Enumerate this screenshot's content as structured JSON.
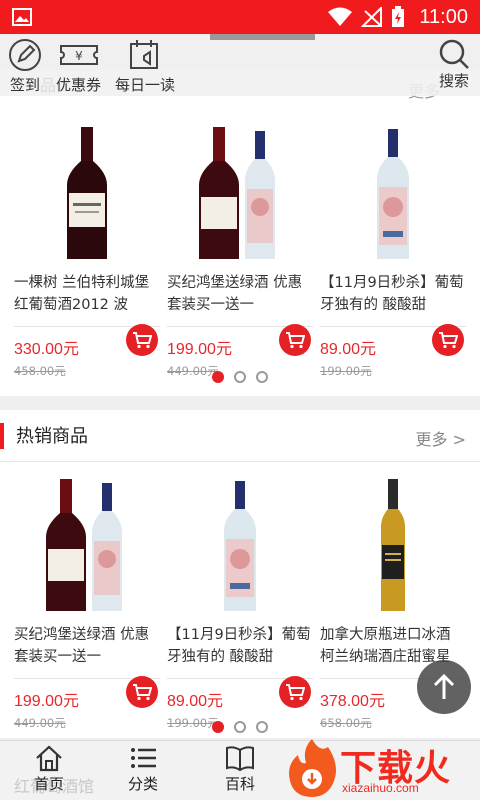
{
  "status": {
    "time": "11:00"
  },
  "toolbar": {
    "items": [
      {
        "label": "签到",
        "icon": "pencil-icon"
      },
      {
        "label": "优惠券",
        "icon": "coupon-icon"
      },
      {
        "label": "每日一读",
        "icon": "calendar-icon"
      }
    ],
    "search_label": "搜索"
  },
  "section1": {
    "title_partial": "品",
    "more": "更多",
    "products": [
      {
        "name": "一棵树 兰伯特利城堡红葡萄酒2012 波",
        "price": "330.00元",
        "old_price": "458.00元"
      },
      {
        "name": "买纪鸿堡送绿酒 优惠套装买一送一",
        "price": "199.00元",
        "old_price": "449.00元"
      },
      {
        "name": "【11月9日秒杀】葡萄牙独有的 酸酸甜",
        "price": "89.00元",
        "old_price": "199.00元"
      }
    ]
  },
  "section2": {
    "title": "热销商品",
    "more": "更多 >",
    "products": [
      {
        "name": "买纪鸿堡送绿酒 优惠套装买一送一",
        "price": "199.00元",
        "old_price": "449.00元"
      },
      {
        "name": "【11月9日秒杀】葡萄牙独有的 酸酸甜",
        "price": "89.00元",
        "old_price": "199.00元"
      },
      {
        "name": "加拿大原瓶进口冰酒 柯兰纳瑞酒庄甜蜜星",
        "price": "378.00元",
        "old_price": "658.00元"
      }
    ]
  },
  "bottom_nav": {
    "background_text": "红葡萄酒馆",
    "items": [
      {
        "label": "首页",
        "icon": "home-icon"
      },
      {
        "label": "分类",
        "icon": "list-icon"
      },
      {
        "label": "百科",
        "icon": "book-icon"
      }
    ]
  },
  "watermark": {
    "main": "下载火",
    "sub": "xiazaihuo.com"
  },
  "colors": {
    "accent": "#f11b1e",
    "price": "#e8262b"
  }
}
